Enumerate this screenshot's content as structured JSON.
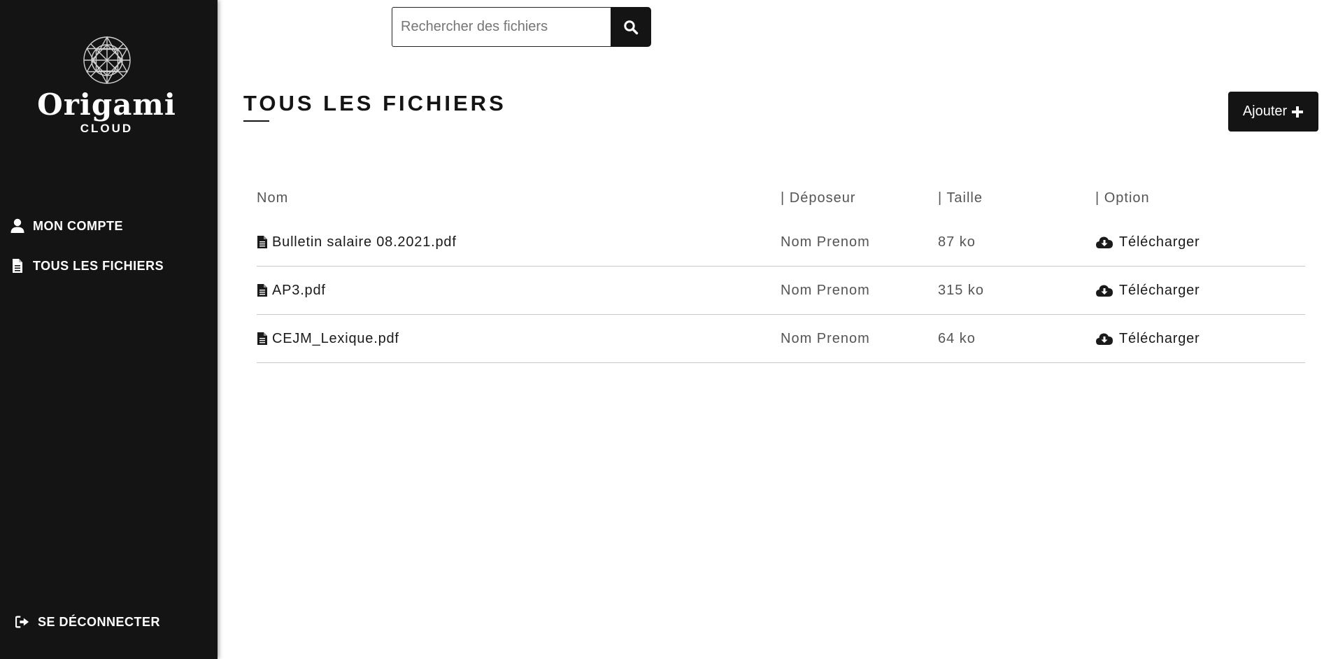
{
  "brand": {
    "name": "Origami",
    "sub": "CLOUD"
  },
  "sidebar": {
    "items": [
      {
        "label": "MON COMPTE",
        "icon": "user-icon"
      },
      {
        "label": "TOUS LES FICHIERS",
        "icon": "file-icon"
      }
    ],
    "logout": {
      "label": "SE DÉCONNECTER",
      "icon": "sign-out-icon"
    }
  },
  "search": {
    "placeholder": "Rechercher des fichiers",
    "value": "",
    "button_icon": "search-icon"
  },
  "main": {
    "title": "TOUS LES FICHIERS",
    "add_label": "Ajouter"
  },
  "table": {
    "headers": [
      "Nom",
      "| Déposeur",
      "| Taille",
      "| Option"
    ],
    "rows": [
      {
        "name": "Bulletin salaire 08.2021.pdf",
        "depositor": "Nom Prenom",
        "size": "87 ko",
        "option": "Télécharger"
      },
      {
        "name": "AP3.pdf",
        "depositor": "Nom Prenom",
        "size": "315 ko",
        "option": "Télécharger"
      },
      {
        "name": "CEJM_Lexique.pdf",
        "depositor": "Nom Prenom",
        "size": "64 ko",
        "option": "Télécharger"
      }
    ]
  },
  "colors": {
    "sidebar_bg": "#141414",
    "accent": "#141414",
    "text": "#1a1a1a",
    "muted": "#555555",
    "row_border": "#c8c8c8"
  }
}
